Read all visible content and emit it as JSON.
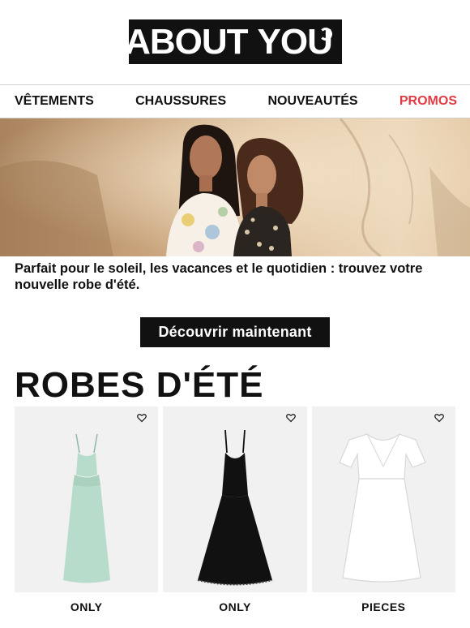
{
  "header": {
    "logo_left": "ABOUT",
    "logo_right": "YOU"
  },
  "nav": {
    "items": [
      {
        "label": "VÊTEMENTS"
      },
      {
        "label": "CHAUSSURES"
      },
      {
        "label": "NOUVEAUTÉS"
      },
      {
        "label": "PROMOS"
      }
    ],
    "promo_color": "#e03a44"
  },
  "hero": {
    "text": "Parfait pour le soleil, les vacances et le quotidien : trouvez votre nouvelle robe d'été.",
    "cta_label": "Découvrir maintenant"
  },
  "section": {
    "title": "ROBES D'ÉTÉ"
  },
  "products": [
    {
      "brand": "ONLY",
      "dress_color": "#b7dccb",
      "icon": "heart-icon"
    },
    {
      "brand": "ONLY",
      "dress_color": "#111111",
      "icon": "heart-icon"
    },
    {
      "brand": "PIECES",
      "dress_color": "#ffffff",
      "icon": "heart-icon"
    }
  ]
}
